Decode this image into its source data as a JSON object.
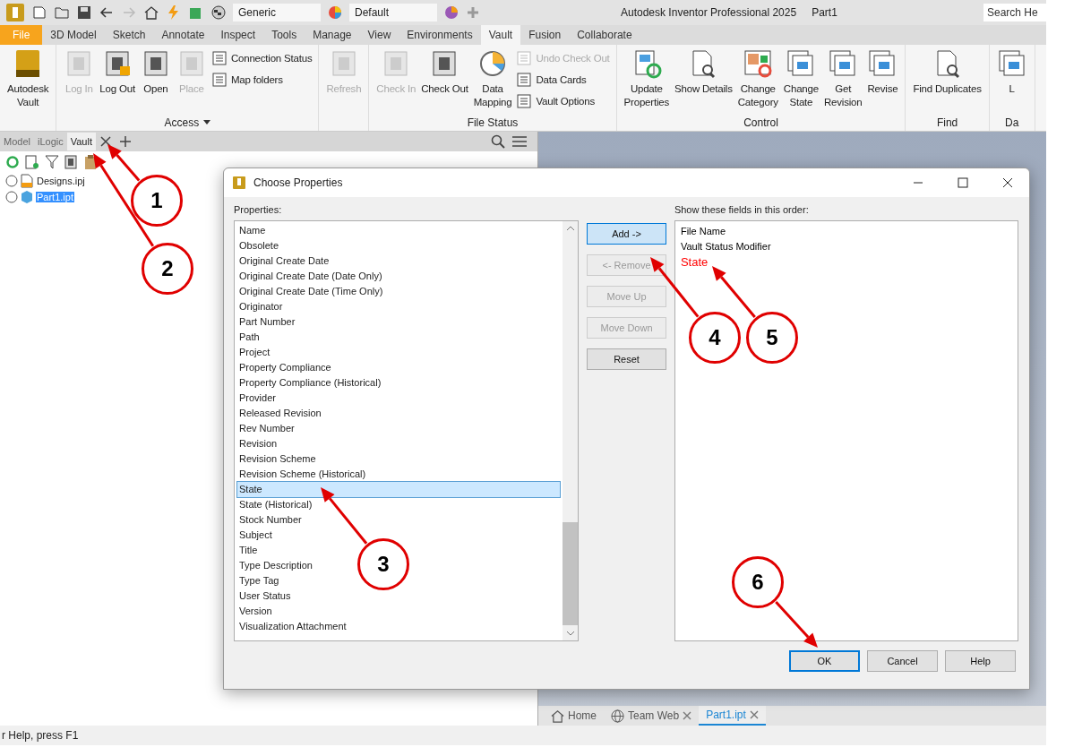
{
  "title_bar": {
    "style_dropdown": "Generic",
    "appearance_dropdown": "Default",
    "title": "Autodesk Inventor Professional 2025",
    "document": "Part1",
    "search": {
      "placeholder": "Search He"
    }
  },
  "ribbon_tabs": [
    {
      "label": "File",
      "selected": false,
      "kind": "file"
    },
    {
      "label": "3D Model",
      "selected": false,
      "kind": "tab"
    },
    {
      "label": "Sketch",
      "selected": false,
      "kind": "tab"
    },
    {
      "label": "Annotate",
      "selected": false,
      "kind": "tab"
    },
    {
      "label": "Inspect",
      "selected": false,
      "kind": "tab"
    },
    {
      "label": "Tools",
      "selected": false,
      "kind": "tab"
    },
    {
      "label": "Manage",
      "selected": false,
      "kind": "tab"
    },
    {
      "label": "View",
      "selected": false,
      "kind": "tab"
    },
    {
      "label": "Environments",
      "selected": false,
      "kind": "tab"
    },
    {
      "label": "Vault",
      "selected": true,
      "kind": "tab"
    },
    {
      "label": "Fusion",
      "selected": false,
      "kind": "tab"
    },
    {
      "label": "Collaborate",
      "selected": false,
      "kind": "tab"
    }
  ],
  "ribbon_groups": [
    {
      "buttons": [
        {
          "label": "Autodesk\nVault",
          "kind": "large",
          "disabled": false
        }
      ]
    },
    {
      "label": "Access",
      "has_menu": true,
      "buttons": [
        {
          "label": "Log In",
          "kind": "large",
          "disabled": true
        },
        {
          "label": "Log Out",
          "kind": "large",
          "disabled": false
        },
        {
          "label": "Open",
          "kind": "large",
          "disabled": false
        },
        {
          "label": "Place",
          "kind": "large",
          "disabled": true
        },
        {
          "label": "Connection Status",
          "kind": "small",
          "disabled": false
        },
        {
          "label": "Map folders",
          "kind": "small",
          "disabled": false
        }
      ]
    },
    {
      "buttons": [
        {
          "label": "Refresh",
          "kind": "large",
          "disabled": true
        }
      ]
    },
    {
      "label": "File Status",
      "buttons": [
        {
          "label": "Check In",
          "kind": "large",
          "disabled": true
        },
        {
          "label": "Check Out",
          "kind": "large",
          "disabled": false
        },
        {
          "label": "Data\nMapping",
          "kind": "large",
          "disabled": false
        },
        {
          "label": "Undo Check Out",
          "kind": "small",
          "disabled": true
        },
        {
          "label": "Data Cards",
          "kind": "small",
          "disabled": false
        },
        {
          "label": "Vault Options",
          "kind": "small",
          "disabled": false
        }
      ]
    },
    {
      "label": "Control",
      "buttons": [
        {
          "label": "Update\nProperties",
          "kind": "large",
          "disabled": false
        },
        {
          "label": "Show Details",
          "kind": "large",
          "disabled": false
        },
        {
          "label": "Change\nCategory",
          "kind": "large",
          "disabled": false
        },
        {
          "label": "Change\nState",
          "kind": "large",
          "disabled": false
        },
        {
          "label": "Get\nRevision",
          "kind": "large",
          "disabled": false
        },
        {
          "label": "Revise",
          "kind": "large",
          "disabled": false
        }
      ]
    },
    {
      "label": "Find",
      "buttons": [
        {
          "label": "Find Duplicates",
          "kind": "large",
          "disabled": false
        }
      ]
    },
    {
      "label": "Da",
      "buttons": [
        {
          "label": "L",
          "kind": "large"
        }
      ]
    }
  ],
  "browser_tabs": [
    {
      "label": "Model",
      "selected": false
    },
    {
      "label": "iLogic",
      "selected": false
    },
    {
      "label": "Vault",
      "selected": true
    }
  ],
  "vault_tree": [
    {
      "label": "Designs.ipj",
      "selected": false,
      "kind": "project"
    },
    {
      "label": "Part1.ipt",
      "selected": true,
      "kind": "part"
    }
  ],
  "document_tabs": [
    {
      "label": "Home",
      "selected": false,
      "closable": false,
      "kind": "home"
    },
    {
      "label": "Team Web",
      "selected": false,
      "closable": true,
      "kind": "web"
    },
    {
      "label": "Part1.ipt",
      "selected": true,
      "closable": true,
      "kind": "document"
    }
  ],
  "status_bar": "r Help, press F1",
  "dialog": {
    "title": "Choose Properties",
    "properties_label": "Properties:",
    "properties": [
      {
        "label": "Name",
        "selected": false
      },
      {
        "label": "Obsolete",
        "selected": false
      },
      {
        "label": "Original Create Date",
        "selected": false
      },
      {
        "label": "Original Create Date (Date Only)",
        "selected": false
      },
      {
        "label": "Original Create Date (Time Only)",
        "selected": false
      },
      {
        "label": "Originator",
        "selected": false
      },
      {
        "label": "Part Number",
        "selected": false
      },
      {
        "label": "Path",
        "selected": false
      },
      {
        "label": "Project",
        "selected": false
      },
      {
        "label": "Property Compliance",
        "selected": false
      },
      {
        "label": "Property Compliance (Historical)",
        "selected": false
      },
      {
        "label": "Provider",
        "selected": false
      },
      {
        "label": "Released Revision",
        "selected": false
      },
      {
        "label": "Rev Number",
        "selected": false
      },
      {
        "label": "Revision",
        "selected": false
      },
      {
        "label": "Revision Scheme",
        "selected": false
      },
      {
        "label": "Revision Scheme (Historical)",
        "selected": false
      },
      {
        "label": "State",
        "selected": true
      },
      {
        "label": "State (Historical)",
        "selected": false
      },
      {
        "label": "Stock Number",
        "selected": false
      },
      {
        "label": "Subject",
        "selected": false
      },
      {
        "label": "Title",
        "selected": false
      },
      {
        "label": "Type Description",
        "selected": false
      },
      {
        "label": "Type Tag",
        "selected": false
      },
      {
        "label": "User Status",
        "selected": false
      },
      {
        "label": "Version",
        "selected": false
      },
      {
        "label": "Visualization Attachment",
        "selected": false
      }
    ],
    "side_buttons": [
      {
        "label": "Add ->",
        "disabled": false,
        "focused": true
      },
      {
        "label": "<- Remove",
        "disabled": true,
        "focused": false
      },
      {
        "label": "Move Up",
        "disabled": true,
        "focused": false
      },
      {
        "label": "Move Down",
        "disabled": true,
        "focused": false
      },
      {
        "label": "Reset",
        "disabled": false,
        "focused": false
      }
    ],
    "order_label": "Show these fields in this order:",
    "order_fields": [
      {
        "label": "File Name",
        "color": "#000000"
      },
      {
        "label": "Vault Status Modifier",
        "color": "#000000"
      },
      {
        "label": "State",
        "color": "#ff0000"
      }
    ],
    "footer_buttons": [
      {
        "label": "OK",
        "focused": true
      },
      {
        "label": "Cancel",
        "focused": false
      },
      {
        "label": "Help",
        "focused": false
      }
    ]
  },
  "annotations": [
    {
      "number": "1"
    },
    {
      "number": "2"
    },
    {
      "number": "3"
    },
    {
      "number": "4"
    },
    {
      "number": "5"
    },
    {
      "number": "6"
    }
  ]
}
